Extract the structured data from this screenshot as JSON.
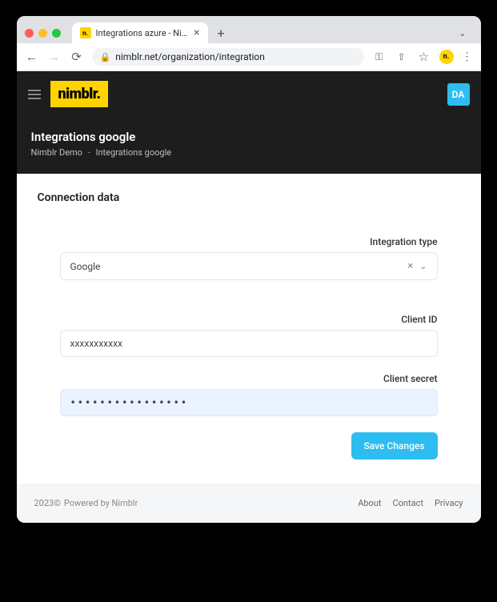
{
  "browser": {
    "tab_title": "Integrations azure - Nimblr Se",
    "url": "nimblr.net/organization/integration",
    "favicon_label": "n."
  },
  "topbar": {
    "logo": "nimblr.",
    "user_initials": "DA"
  },
  "header": {
    "title": "Integrations google",
    "crumb_org": "Nimblr Demo",
    "crumb_sep": "-",
    "crumb_page": "Integrations google"
  },
  "form": {
    "section_title": "Connection data",
    "integration_type_label": "Integration type",
    "integration_type_value": "Google",
    "client_id_label": "Client ID",
    "client_id_value": "xxxxxxxxxxx",
    "client_secret_label": "Client secret",
    "client_secret_value": "••••••••••••••••",
    "save_label": "Save Changes"
  },
  "footer": {
    "year": "2023©",
    "powered": "Powered by Nimblr",
    "about": "About",
    "contact": "Contact",
    "privacy": "Privacy"
  }
}
